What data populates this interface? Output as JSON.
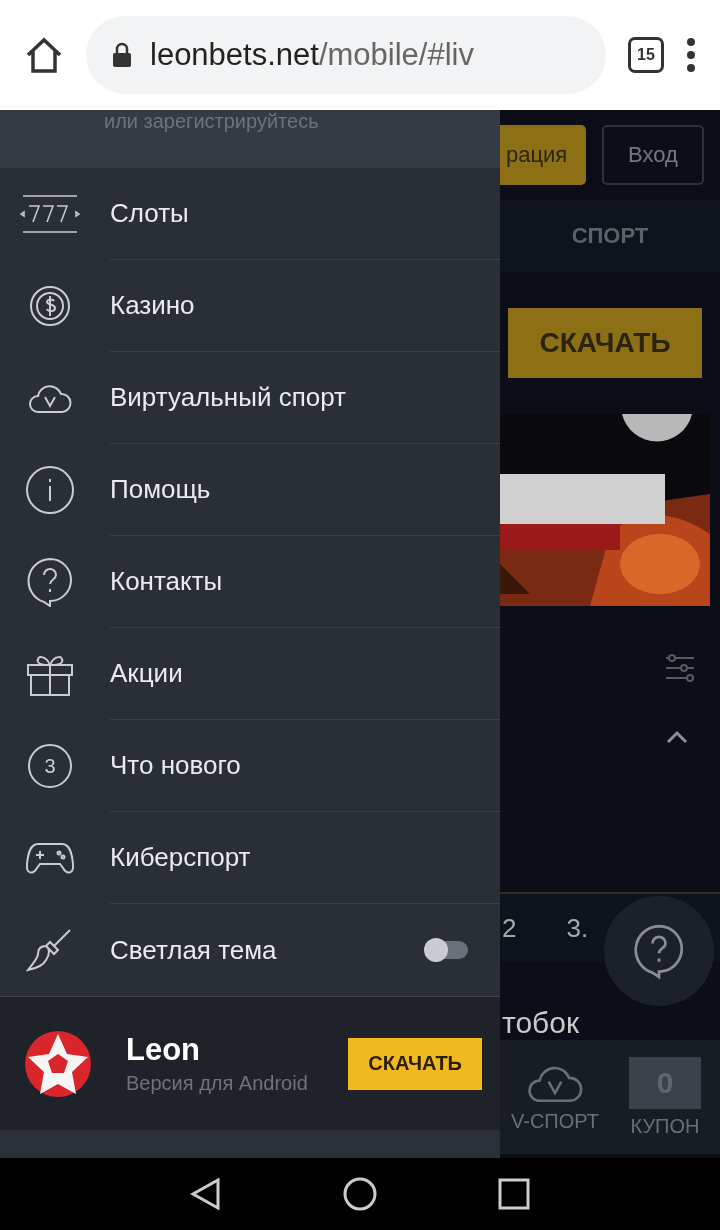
{
  "browser": {
    "url_host": "leonbets.net",
    "url_path": "/mobile/#liv",
    "tab_count": "15"
  },
  "drawer": {
    "header_text": "или зарегистрируйтесь",
    "items": [
      {
        "kind": "link",
        "label": "Слоты"
      },
      {
        "kind": "link",
        "label": "Казино"
      },
      {
        "kind": "link",
        "label": "Виртуальный спорт"
      },
      {
        "kind": "link",
        "label": "Помощь"
      },
      {
        "kind": "link",
        "label": "Контакты"
      },
      {
        "kind": "link",
        "label": "Акции"
      },
      {
        "kind": "badge",
        "label": "Что нового",
        "badge": "3"
      },
      {
        "kind": "link",
        "label": "Киберспорт"
      },
      {
        "kind": "toggle",
        "label": "Светлая тема",
        "on": false
      }
    ],
    "app_banner": {
      "title": "Leon",
      "subtitle": "Версия для Android",
      "button": "СКАЧАТЬ"
    }
  },
  "page": {
    "register_button": "рация",
    "login_button": "Вход",
    "tab": "СПОРТ",
    "download_button": "СКАЧАТЬ",
    "odds_label": "2",
    "odds_value": "3.",
    "cut_text": "тобок",
    "bottom_tabs": [
      {
        "label": "V-СПОРТ",
        "kind": "icon"
      },
      {
        "label": "КУПОН",
        "kind": "counter",
        "count": "0"
      }
    ]
  }
}
